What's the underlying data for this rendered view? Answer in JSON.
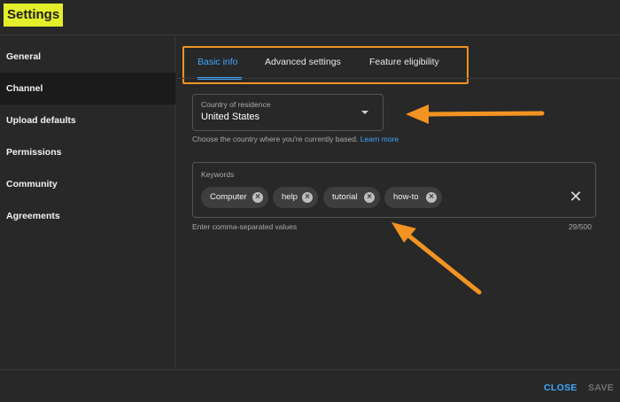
{
  "header": {
    "title": "Settings"
  },
  "sidebar": {
    "items": [
      {
        "label": "General"
      },
      {
        "label": "Channel"
      },
      {
        "label": "Upload defaults"
      },
      {
        "label": "Permissions"
      },
      {
        "label": "Community"
      },
      {
        "label": "Agreements"
      }
    ],
    "active": "Channel"
  },
  "tabs": {
    "items": [
      {
        "label": "Basic info"
      },
      {
        "label": "Advanced settings"
      },
      {
        "label": "Feature eligibility"
      }
    ],
    "active": "Basic info"
  },
  "country": {
    "label": "Country of residence",
    "value": "United States",
    "helper": "Choose the country where you're currently based.",
    "learn_more": "Learn more"
  },
  "keywords": {
    "label": "Keywords",
    "chips": [
      {
        "label": "Computer"
      },
      {
        "label": "help"
      },
      {
        "label": "tutorial"
      },
      {
        "label": "how-to"
      }
    ],
    "helper": "Enter comma-separated values",
    "count": "29/500"
  },
  "footer": {
    "close_label": "CLOSE",
    "save_label": "SAVE"
  },
  "colors": {
    "accent": "#3ea6ff",
    "annotation": "#f29322",
    "title_highlight": "#e4ee2a",
    "background": "#282828"
  },
  "icons": {
    "dropdown": "caret-down-icon",
    "chip_remove": "remove-chip-icon",
    "clear": "close-icon"
  }
}
